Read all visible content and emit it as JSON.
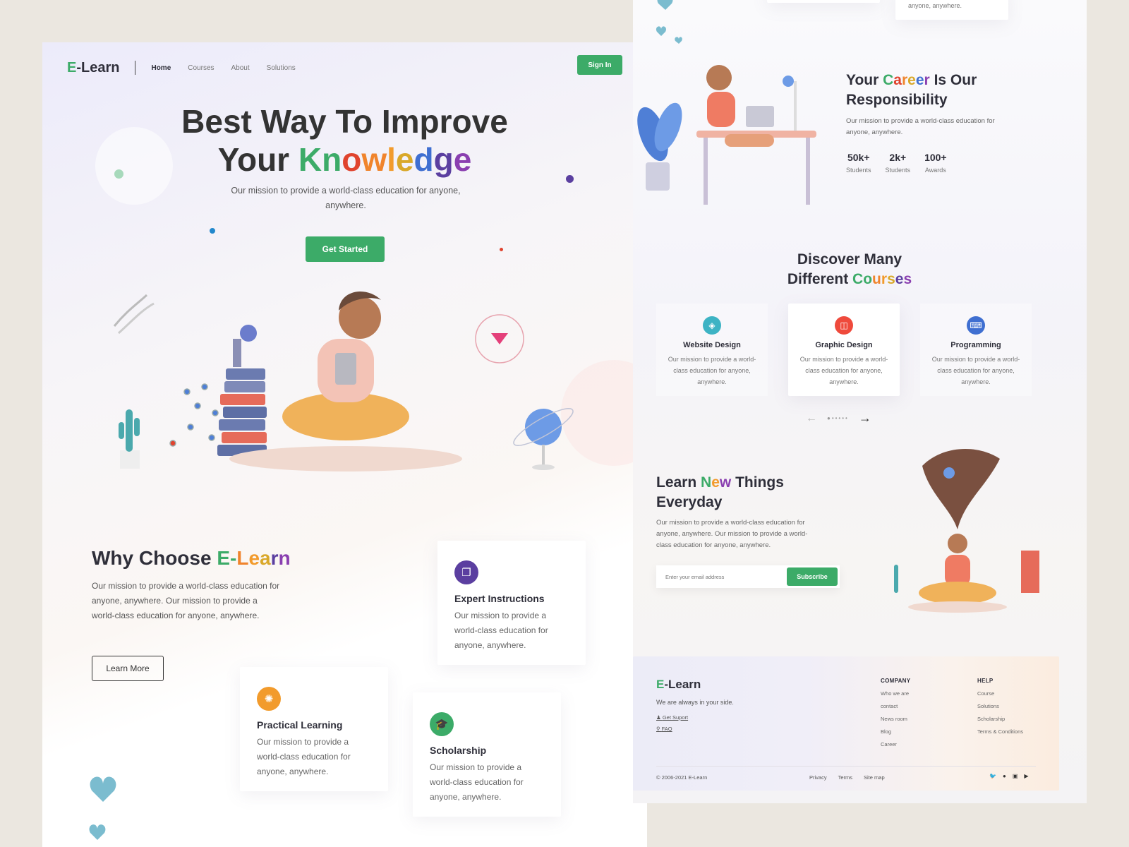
{
  "brand": {
    "logo_e": "E",
    "logo_rest": "-Learn",
    "green": "#3cab68"
  },
  "nav": {
    "links": [
      "Home",
      "Courses",
      "About",
      "Solutions"
    ],
    "signin": "Sign In"
  },
  "hero": {
    "title_line1": "Best Way To Improve",
    "title_line2_prefix": "Your ",
    "title_highlight": "Knowledge",
    "subtitle": "Our mission to provide a  world-class education for anyone, anywhere.",
    "cta": "Get Started"
  },
  "why": {
    "title_prefix": "Why Choose ",
    "title_highlight": "E-Learn",
    "text": "Our mission to provide a  world-class education for anyone, anywhere. Our mission to provide a  world-class education for anyone, anywhere.",
    "learn_more": "Learn More",
    "cards": [
      {
        "title": "Expert Instructions",
        "text": "Our mission to provide a world-class education for anyone, anywhere.",
        "icon": "layers-icon",
        "color": "#5b3fa0"
      },
      {
        "title": "Practical Learning",
        "text": "Our mission to provide a world-class education for anyone, anywhere.",
        "icon": "brain-icon",
        "color": "#f29b2c"
      },
      {
        "title": "Scholarship",
        "text": "Our mission to provide a world-class education for anyone, anywhere.",
        "icon": "graduation-cap-icon",
        "color": "#3cab68"
      }
    ]
  },
  "top_snippet": {
    "text": "anyone, anywhere."
  },
  "career": {
    "title_prefix": "Your ",
    "title_highlight": "Career",
    "title_suffix": " Is Our",
    "title_line2": "Responsibility",
    "text": "Our mission to provide a  world-class education for anyone, anywhere.",
    "stats": [
      {
        "value": "50k+",
        "label": "Students"
      },
      {
        "value": "2k+",
        "label": "Students"
      },
      {
        "value": "100+",
        "label": "Awards"
      }
    ]
  },
  "discover": {
    "title_line1": "Discover Many",
    "title_line2_prefix": "Different ",
    "title_highlight": "Courses",
    "courses": [
      {
        "title": "Website Design",
        "text": "Our mission to provide a world-class education for anyone, anywhere.",
        "icon": "target-icon",
        "color": "#3db3c4"
      },
      {
        "title": "Graphic Design",
        "text": "Our mission to provide a world-class education for anyone, anywhere.",
        "icon": "shapes-icon",
        "color": "#ef4a3c"
      },
      {
        "title": "Programming",
        "text": "Our mission to provide a world-class education for anyone, anywhere.",
        "icon": "code-icon",
        "color": "#3f6fd1"
      }
    ]
  },
  "learn_new": {
    "title_prefix": "Learn ",
    "title_highlight": "New",
    "title_suffix": " Things",
    "title_line2": "Everyday",
    "text": "Our mission to provide a  world-class education for anyone, anywhere. Our mission to provide a  world-class education for anyone, anywhere.",
    "email_placeholder": "Enter your email address",
    "subscribe": "Subscribe"
  },
  "footer": {
    "brand_e": "E",
    "brand_rest": "-Learn",
    "tagline": "We are always in your side.",
    "support": "Get Suport",
    "faq": "FAQ",
    "company_title": "COMPANY",
    "company_links": [
      "Who we are",
      "contact",
      "News room",
      "Blog",
      "Career"
    ],
    "help_title": "HELP",
    "help_links": [
      "Course",
      "Solutions",
      "Scholarship",
      "Terms & Conditions"
    ],
    "copyright": "© 2006-2021 E-Learn",
    "bottom_links": [
      "Privacy",
      "Terms",
      "Site map"
    ]
  }
}
